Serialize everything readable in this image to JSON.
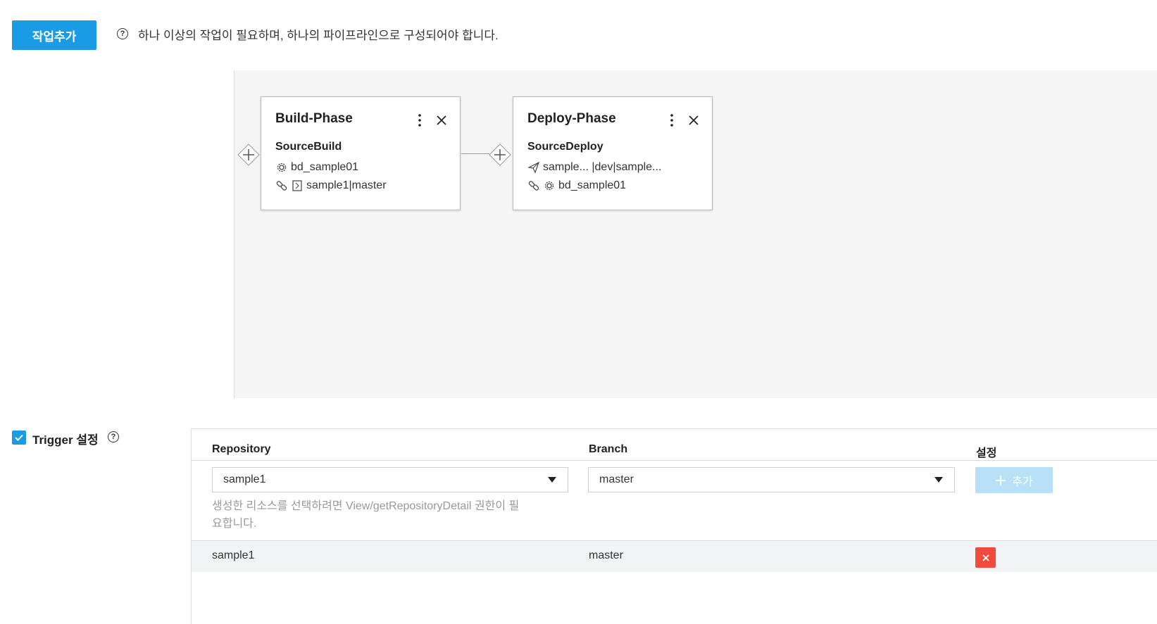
{
  "toolbar": {
    "add_job_label": "작업추가",
    "help_text": "하나 이상의 작업이 필요하며, 하나의 파이프라인으로 구성되어야 합니다."
  },
  "pipeline": {
    "phases": [
      {
        "title": "Build-Phase",
        "job": "SourceBuild",
        "line1": "bd_sample01",
        "line2": "sample1|master",
        "line1_icon": "gear-icon",
        "line2_icons": [
          "link-icon",
          "repository-icon"
        ]
      },
      {
        "title": "Deploy-Phase",
        "job": "SourceDeploy",
        "line1": "sample... |dev|sample...",
        "line2": "bd_sample01",
        "line1_icon": "send-icon",
        "line2_icons": [
          "link-icon",
          "gear-icon"
        ]
      }
    ]
  },
  "trigger": {
    "checked": true,
    "label": "Trigger 설정",
    "columns": {
      "repository": "Repository",
      "branch": "Branch",
      "settings": "설정"
    },
    "repository_select": "sample1",
    "branch_select": "master",
    "hint_line1": "생성한 리소스를 선택하려면 View/getRepositoryDetail 권한이 필",
    "hint_line2": "요합니다.",
    "add_label": "추가",
    "rows": [
      {
        "repository": "sample1",
        "branch": "master"
      }
    ]
  },
  "colors": {
    "primary": "#1a9be6",
    "primary_disabled": "#b8e0f7",
    "danger": "#f24a3b",
    "canvas_bg": "#f5f5f5"
  }
}
